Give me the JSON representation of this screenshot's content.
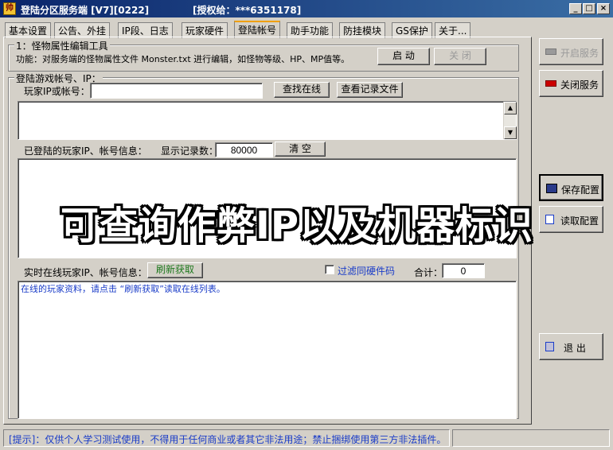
{
  "window": {
    "title": "登陆分区服务端 [V7][0222]",
    "license": "[授权给：***6351178]",
    "min_glyph": "_",
    "max_glyph": "□",
    "close_glyph": "×"
  },
  "tabs": [
    {
      "label": "基本设置"
    },
    {
      "label": "公告、外挂"
    },
    {
      "label": "IP段、日志"
    },
    {
      "label": "玩家硬件"
    },
    {
      "label": "登陆帐号",
      "active": true
    },
    {
      "label": "助手功能"
    },
    {
      "label": "防挂模块"
    },
    {
      "label": "GS保护"
    },
    {
      "label": "关于..."
    }
  ],
  "monster_tool": {
    "group_label": "1：怪物属性编辑工具",
    "description": "功能：对服务端的怪物属性文件 Monster.txt 进行编辑，如怪物等级、HP、MP值等。",
    "start_label": "启 动",
    "close_label": "关 闭"
  },
  "login": {
    "group_label": "登陆游戏帐号、IP：",
    "ip_label": "玩家IP或帐号：",
    "ip_value": "",
    "find_online_label": "查找在线",
    "view_log_label": "查看记录文件",
    "logged_label": "已登陆的玩家IP、帐号信息：",
    "show_count_label": "显示记录数：",
    "show_count_value": "80000",
    "clear_label": "清 空",
    "realtime_label": "实时在线玩家IP、帐号信息：",
    "refresh_label": "刷新获取",
    "filter_label": "过滤同硬件码",
    "filter_checked": false,
    "total_label": "合计：",
    "total_value": "0",
    "online_hint": "在线的玩家资料，请点击 “刷新获取”读取在线列表。"
  },
  "overlay_text": "可查询作弊IP以及机器标识",
  "side_buttons": {
    "start_service": "开启服务",
    "stop_service": "关闭服务",
    "save_config": "保存配置",
    "load_config": "读取配置",
    "exit": "退  出"
  },
  "status": {
    "hint": "[提示]：仅供个人学习测试使用，不得用于任何商业或者其它非法用途；禁止捆绑使用第三方非法插件。"
  },
  "colors": {
    "title_bar": "#0a246a",
    "tab_active_accent": "#f0a000",
    "hint_blue": "#1a3cc8",
    "refresh_green": "#1f7a1f",
    "stop_red": "#cc0000"
  }
}
